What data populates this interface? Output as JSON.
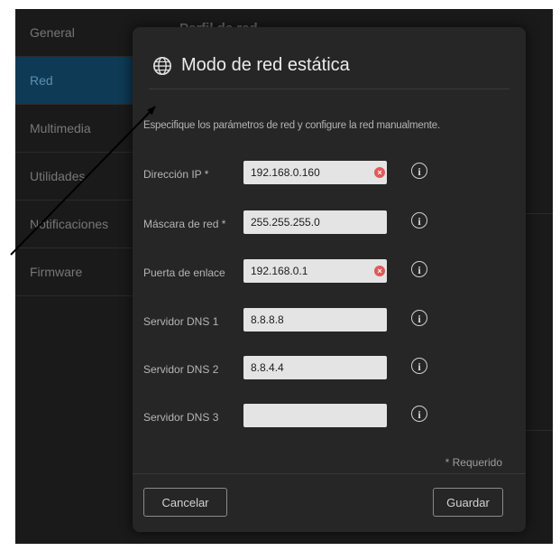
{
  "sidebar": {
    "items": [
      {
        "label": "General"
      },
      {
        "label": "Red"
      },
      {
        "label": "Multimedia"
      },
      {
        "label": "Utilidades"
      },
      {
        "label": "Notificaciones"
      },
      {
        "label": "Firmware"
      }
    ],
    "active_index": 1
  },
  "background": {
    "title": "Perfil de red"
  },
  "dialog": {
    "title": "Modo de red estática",
    "title_icon": "globe-icon",
    "description": "Especifique los parámetros de red y configure la red manualmente.",
    "fields": [
      {
        "label": "Dirección IP *",
        "value": "192.168.0.160",
        "has_error": true
      },
      {
        "label": "Máscara de red *",
        "value": "255.255.255.0",
        "has_error": false
      },
      {
        "label": "Puerta de enlace",
        "value": "192.168.0.1",
        "has_error": true
      },
      {
        "label": "Servidor DNS 1",
        "value": "8.8.8.8",
        "has_error": false
      },
      {
        "label": "Servidor DNS 2",
        "value": "8.8.4.4",
        "has_error": false
      },
      {
        "label": "Servidor DNS 3",
        "value": "",
        "has_error": false
      }
    ],
    "required_note": "* Requerido",
    "cancel_label": "Cancelar",
    "save_label": "Guardar"
  },
  "colors": {
    "background": "#1a1a1a",
    "dialog": "#262626",
    "active_sidebar": "#0e3a55",
    "error": "#e05a5a",
    "input": "#e4e4e4"
  }
}
